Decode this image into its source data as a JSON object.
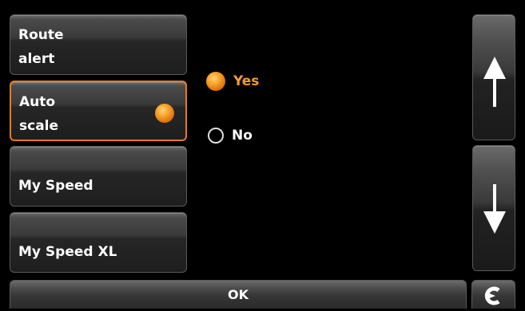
{
  "menu": {
    "items": [
      {
        "label_line1": "Route",
        "label_line2": "alert"
      },
      {
        "label_line1": "Auto",
        "label_line2": "scale",
        "selected": true
      },
      {
        "label": "My Speed"
      },
      {
        "label": "My Speed XL"
      }
    ]
  },
  "options": {
    "yes_label": "Yes",
    "no_label": "No",
    "selected": "Yes"
  },
  "scroll": {
    "up_icon": "arrow-up-icon",
    "down_icon": "arrow-down-icon"
  },
  "footer": {
    "ok_label": "OK",
    "back_icon": "back-arrow-icon"
  },
  "colors": {
    "accent": "#f59b33",
    "selection_border": "#e87a1c",
    "background": "#000000"
  }
}
